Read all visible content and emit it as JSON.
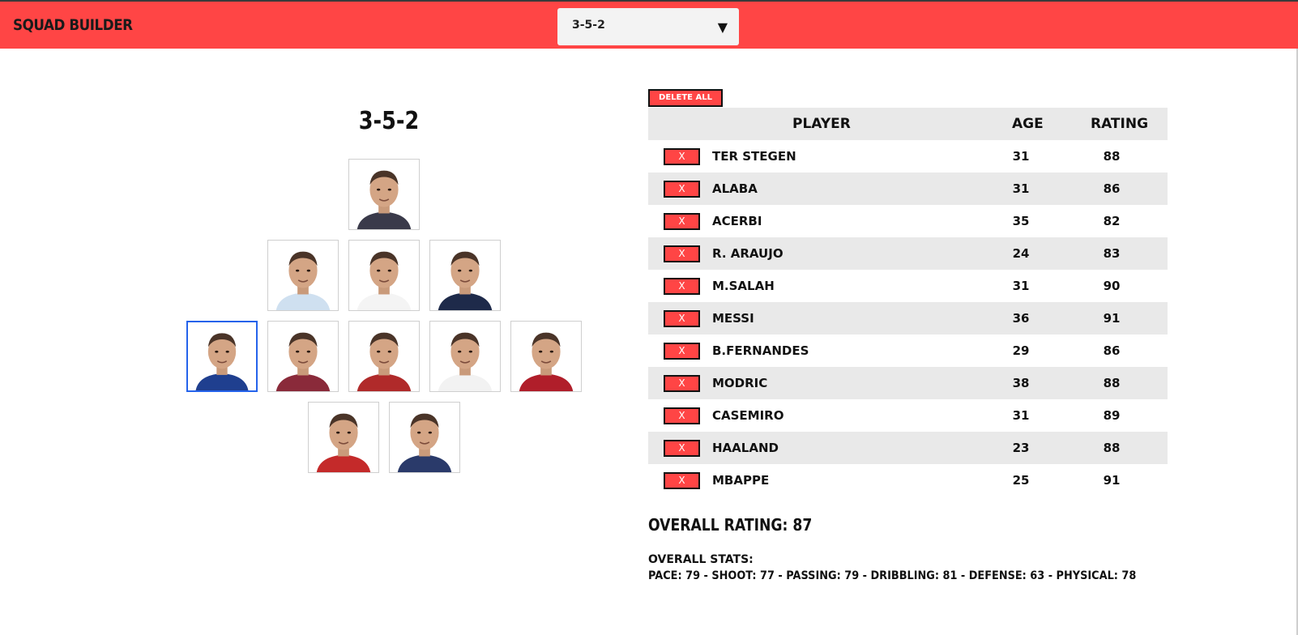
{
  "app": {
    "title": "SQUAD BUILDER"
  },
  "formation_select": {
    "value": "3-5-2"
  },
  "pitch": {
    "title": "3-5-2",
    "players": [
      {
        "name": "TER STEGEN",
        "row": 0,
        "kit": "#3a3a4a"
      },
      {
        "name": "ACERBI",
        "row": 1,
        "kit": "#cfe0f0"
      },
      {
        "name": "ALABA",
        "row": 1,
        "kit": "#f4f4f4"
      },
      {
        "name": "R. ARAUJO",
        "row": 1,
        "kit": "#1e2a4a"
      },
      {
        "name": "MBAPPE",
        "row": 2,
        "kit": "#1f3f8f",
        "selected": true
      },
      {
        "name": "CASEMIRO",
        "row": 2,
        "kit": "#8a2a3a"
      },
      {
        "name": "B.FERNANDES",
        "row": 2,
        "kit": "#b02a2a"
      },
      {
        "name": "MODRIC",
        "row": 2,
        "kit": "#f2f2f2"
      },
      {
        "name": "M.SALAH",
        "row": 2,
        "kit": "#b01e2a"
      },
      {
        "name": "HAALAND",
        "row": 3,
        "kit": "#c42a2a"
      },
      {
        "name": "MESSI",
        "row": 3,
        "kit": "#2a3a6a"
      }
    ]
  },
  "table": {
    "delete_all": "DELETE ALL",
    "headers": {
      "player": "PLAYER",
      "age": "AGE",
      "rating": "RATING"
    },
    "remove_label": "X",
    "rows": [
      {
        "player": "TER STEGEN",
        "age": "31",
        "rating": "88"
      },
      {
        "player": "ALABA",
        "age": "31",
        "rating": "86"
      },
      {
        "player": "ACERBI",
        "age": "35",
        "rating": "82"
      },
      {
        "player": "R. ARAUJO",
        "age": "24",
        "rating": "83"
      },
      {
        "player": "M.SALAH",
        "age": "31",
        "rating": "90"
      },
      {
        "player": "MESSI",
        "age": "36",
        "rating": "91"
      },
      {
        "player": "B.FERNANDES",
        "age": "29",
        "rating": "86"
      },
      {
        "player": "MODRIC",
        "age": "38",
        "rating": "88"
      },
      {
        "player": "CASEMIRO",
        "age": "31",
        "rating": "89"
      },
      {
        "player": "HAALAND",
        "age": "23",
        "rating": "88"
      },
      {
        "player": "MBAPPE",
        "age": "25",
        "rating": "91"
      }
    ]
  },
  "summary": {
    "overall_rating": "OVERALL RATING: 87",
    "stats_label": "OVERALL STATS:",
    "stats_line": "PACE: 79 - SHOOT: 77 - PASSING: 79 - DRIBBLING: 81 - DEFENSE: 63 - PHYSICAL: 78"
  },
  "colors": {
    "accent": "#ff4545",
    "row_shade": "#e9e9e9",
    "selected_border": "#2563eb"
  }
}
